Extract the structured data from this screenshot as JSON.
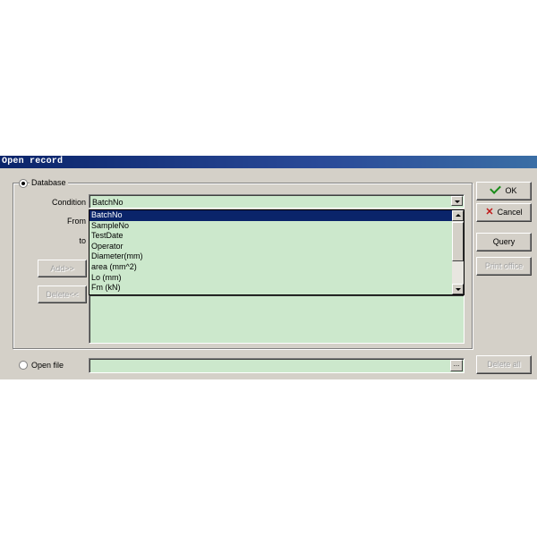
{
  "window": {
    "title": "Open record"
  },
  "database": {
    "radio_label": "Database",
    "condition_label": "Condition",
    "condition_value": "BatchNo",
    "from_label": "From",
    "to_label": "to",
    "options": [
      "BatchNo",
      "SampleNo",
      "TestDate",
      "Operator",
      "Diameter(mm)",
      "area (mm^2)",
      "Lo (mm)",
      "Fm (kN)"
    ],
    "selected_option": "BatchNo",
    "add_label": "Add>>",
    "delete_label": "Delete<<"
  },
  "open_file": {
    "radio_label": "Open file",
    "value": "",
    "browse_label": "..."
  },
  "buttons": {
    "ok": "OK",
    "cancel": "Cancel",
    "query": "Query",
    "print_office": "Print office",
    "delete_all": "Delete all"
  },
  "icons": {
    "ok": "check-icon",
    "cancel": "x-icon"
  },
  "colors": {
    "field_bg": "#cce8cc",
    "titlebar": "#0a246a",
    "dialog_bg": "#d4d0c8"
  }
}
